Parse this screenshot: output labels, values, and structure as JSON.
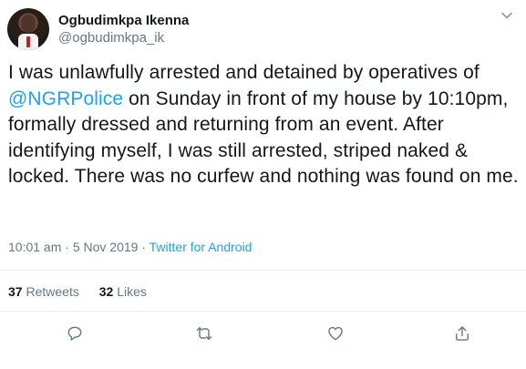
{
  "tweet": {
    "author": {
      "display_name": "Ogbudimkpa Ikenna",
      "handle": "@ogbudimkpa_ik"
    },
    "text_segments": [
      "I was unlawfully arrested and detained by operatives of ",
      "@NGRPolice",
      " on Sunday in front of my house by 10:10pm, formally dressed and returning from an event. After identifying myself, I was still arrested, striped naked & locked. There was no curfew and nothing was found on me."
    ],
    "time": "10:01 am",
    "separator": "·",
    "date": "5 Nov 2019",
    "source": "Twitter for Android",
    "stats": {
      "retweets_count": "37",
      "retweets_label": "Retweets",
      "likes_count": "32",
      "likes_label": "Likes"
    },
    "icons": {
      "menu": "chevron-down-icon",
      "reply": "reply-icon",
      "retweet": "retweet-icon",
      "like": "heart-icon",
      "share": "share-icon"
    },
    "colors": {
      "link": "#1da1f2",
      "muted": "#657786",
      "text": "#14171a",
      "divider": "#e6ecf0"
    }
  }
}
